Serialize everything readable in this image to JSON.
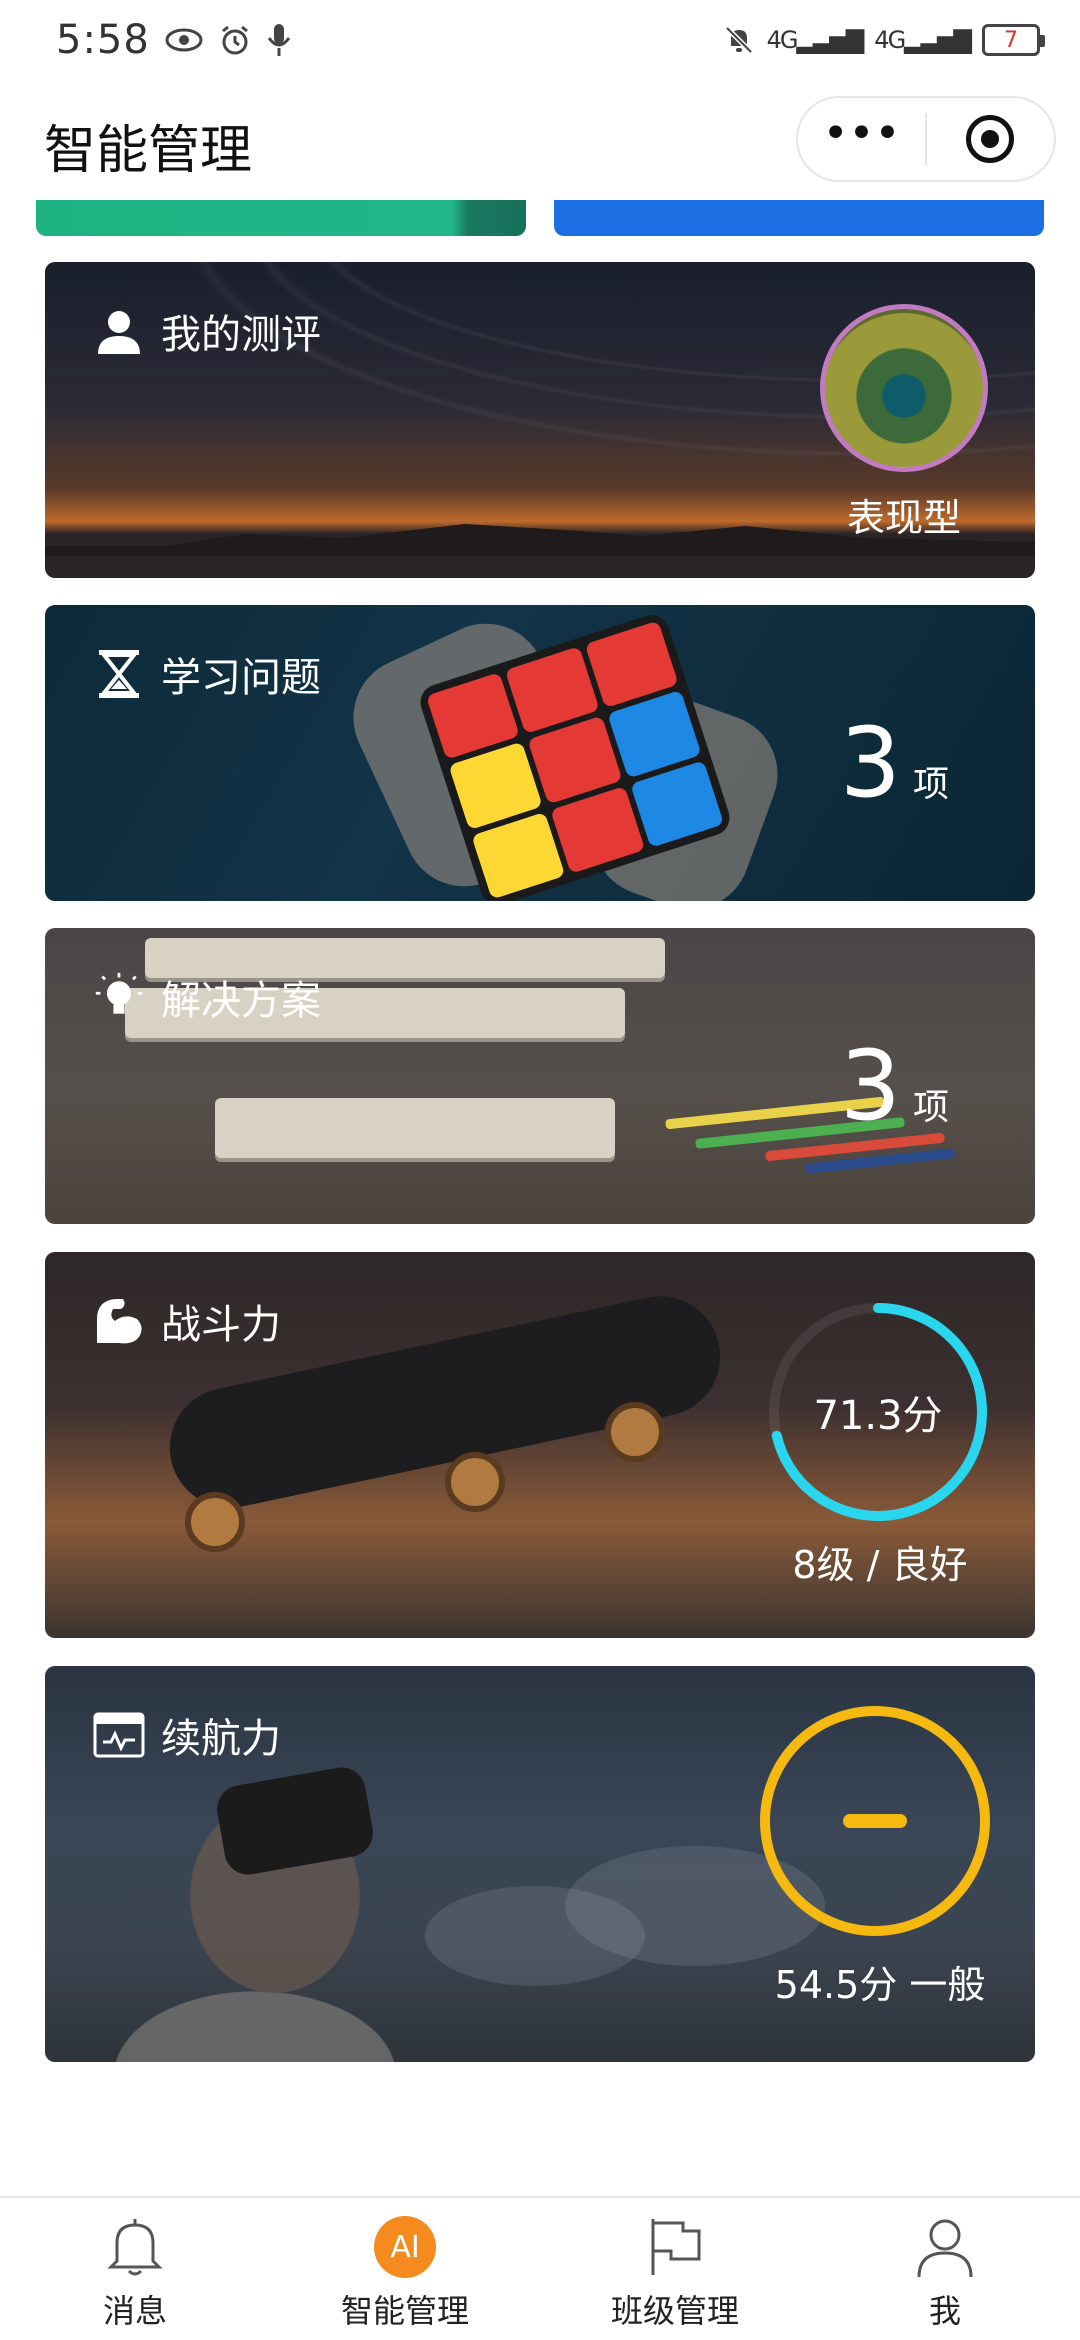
{
  "status_bar": {
    "time": "5:58",
    "signal_1": "4G",
    "signal_2": "4G",
    "battery": "7"
  },
  "header": {
    "title": "智能管理"
  },
  "cards": {
    "evaluation": {
      "label": "我的测评",
      "avatar_label": "表现型"
    },
    "study_problems": {
      "label": "学习问题",
      "count": "3",
      "unit": "项"
    },
    "solutions": {
      "label": "解决方案",
      "count": "3",
      "unit": "项"
    },
    "combat_power": {
      "label": "战斗力",
      "score": "71.3分",
      "score_value": 71.3,
      "ring_color": "#29d6ee",
      "level": "8级 / 良好"
    },
    "endurance": {
      "label": "续航力",
      "summary": "54.5分 一般",
      "ring_color": "#f5b90f"
    }
  },
  "tab_bar": {
    "items": [
      {
        "label": "消息",
        "icon": "bell-icon"
      },
      {
        "label": "智能管理",
        "icon": "ai-badge-icon",
        "badge": "AI",
        "active": true
      },
      {
        "label": "班级管理",
        "icon": "flag-icon"
      },
      {
        "label": "我",
        "icon": "user-icon"
      }
    ]
  }
}
